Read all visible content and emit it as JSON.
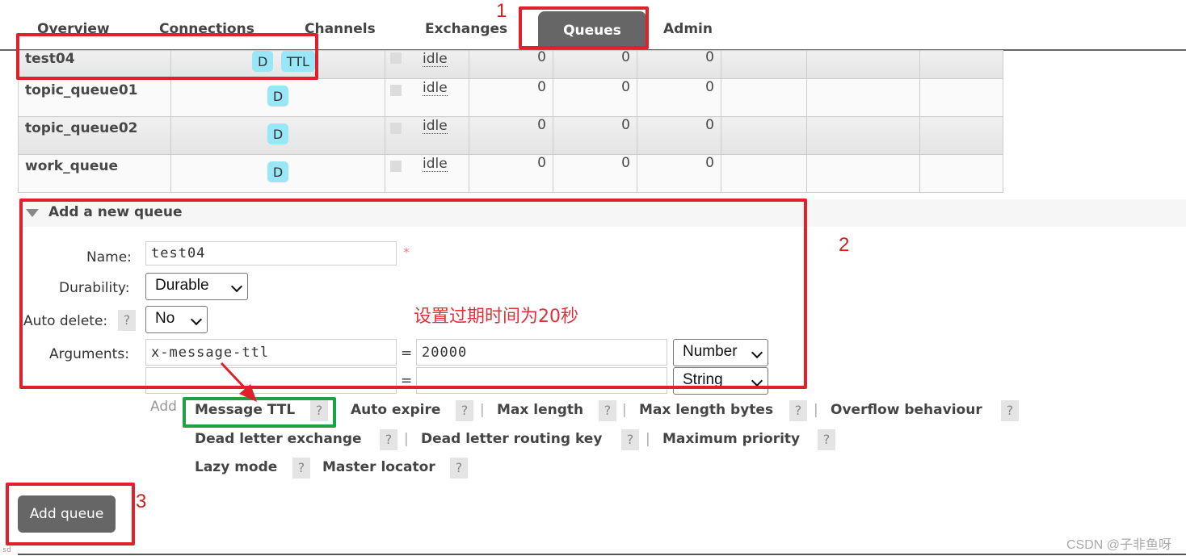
{
  "nav": {
    "tabs": [
      {
        "label": "Overview",
        "active": false
      },
      {
        "label": "Connections",
        "active": false
      },
      {
        "label": "Channels",
        "active": false
      },
      {
        "label": "Exchanges",
        "active": false
      },
      {
        "label": "Queues",
        "active": true
      },
      {
        "label": "Admin",
        "active": false
      }
    ]
  },
  "queues": {
    "rows": [
      {
        "name": "test04",
        "features": [
          "D",
          "TTL"
        ],
        "state": "idle",
        "ready": "0",
        "unacked": "0",
        "total": "0"
      },
      {
        "name": "topic_queue01",
        "features": [
          "D"
        ],
        "state": "idle",
        "ready": "0",
        "unacked": "0",
        "total": "0"
      },
      {
        "name": "topic_queue02",
        "features": [
          "D"
        ],
        "state": "idle",
        "ready": "0",
        "unacked": "0",
        "total": "0"
      },
      {
        "name": "work_queue",
        "features": [
          "D"
        ],
        "state": "idle",
        "ready": "0",
        "unacked": "0",
        "total": "0"
      }
    ]
  },
  "add_queue": {
    "title": "Add a new queue",
    "name_label": "Name:",
    "name_value": "test04",
    "required_mark": "*",
    "durability_label": "Durability:",
    "durability_value": "Durable",
    "auto_delete_label": "Auto delete:",
    "auto_delete_value": "No",
    "help_glyph": "?",
    "arguments_label": "Arguments:",
    "arguments": [
      {
        "key": "x-message-ttl",
        "value": "20000",
        "type": "Number"
      },
      {
        "key": "",
        "value": "",
        "type": "String"
      }
    ],
    "equals": "=",
    "add_label": "Add",
    "shortcuts_row1": [
      "Message TTL",
      "Auto expire",
      "Max length",
      "Max length bytes",
      "Overflow behaviour"
    ],
    "shortcuts_row2": [
      "Dead letter exchange",
      "Dead letter routing key",
      "Maximum priority"
    ],
    "shortcuts_row3": [
      "Lazy mode",
      "Master locator"
    ],
    "separator": "|",
    "submit_label": "Add queue"
  },
  "annotations": {
    "step1": "1",
    "step2": "2",
    "step3": "3",
    "note": "设置过期时间为20秒",
    "accent_red": "#e0202a",
    "accent_green": "#20a040"
  },
  "footer": {
    "tiny_text": "sd",
    "watermark": "CSDN @子非鱼呀"
  }
}
